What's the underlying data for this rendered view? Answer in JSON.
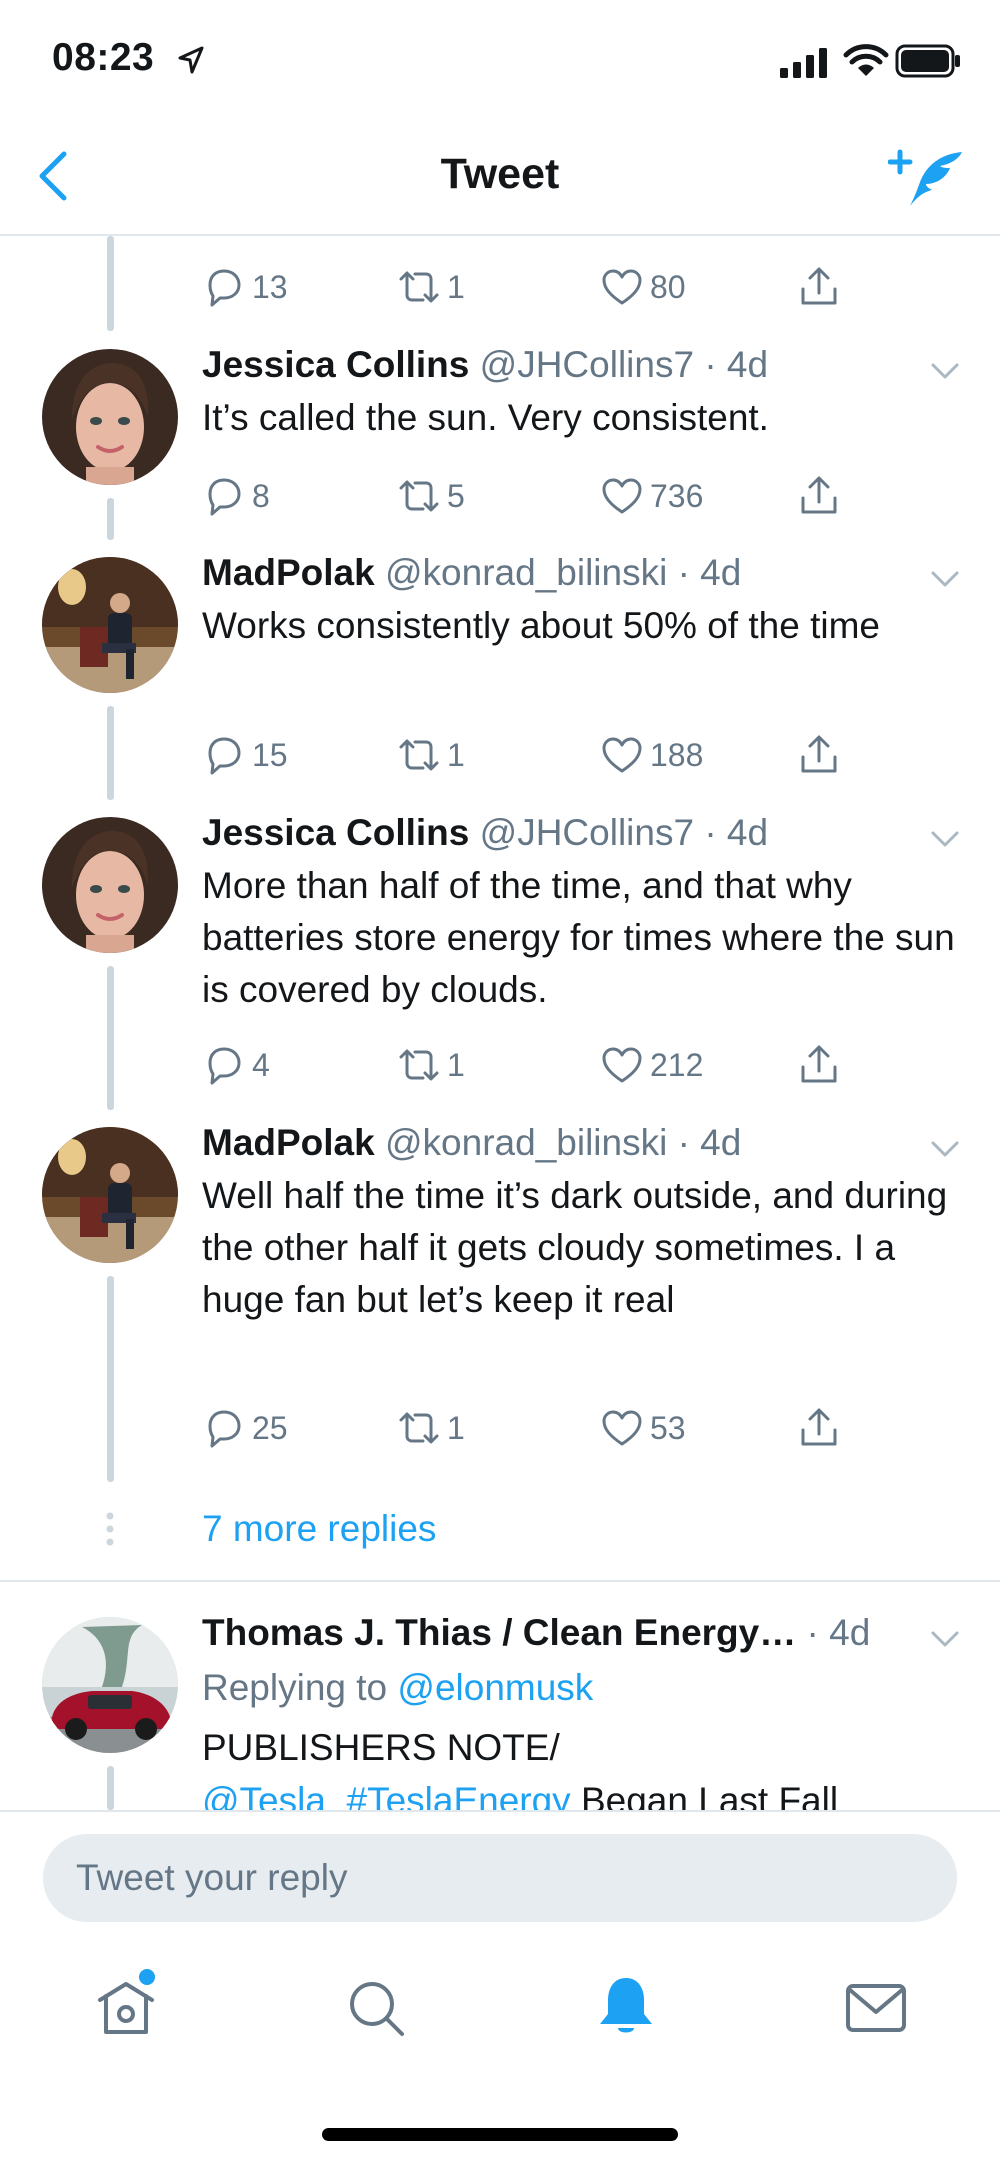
{
  "status_bar": {
    "time": "08:23"
  },
  "nav": {
    "title": "Tweet"
  },
  "top_actions": {
    "replies": "13",
    "retweets": "1",
    "likes": "80"
  },
  "tweets": [
    {
      "name": "Jessica Collins",
      "handle": "@JHCollins7 · 4d",
      "text": "It’s called the sun. Very consistent.",
      "replies": "8",
      "retweets": "5",
      "likes": "736"
    },
    {
      "name": "MadPolak",
      "handle": "@konrad_bilinski · 4d",
      "text": "Works consistently about 50% of the time",
      "replies": "15",
      "retweets": "1",
      "likes": "188"
    },
    {
      "name": "Jessica Collins",
      "handle": "@JHCollins7 · 4d",
      "text": "More than half of the time, and that why batteries store energy for times where the sun is covered by clouds.",
      "replies": "4",
      "retweets": "1",
      "likes": "212"
    },
    {
      "name": "MadPolak",
      "handle": "@konrad_bilinski · 4d",
      "text": "Well half the time it’s dark outside, and during the other half it gets cloudy sometimes. I a huge fan but let’s keep it real",
      "replies": "25",
      "retweets": "1",
      "likes": "53"
    }
  ],
  "more_replies": "7 more replies",
  "bottom_tweet": {
    "name": "Thomas J. Thias / Clean Energy…",
    "time": "· 4d",
    "replying_prefix": "Replying to",
    "replying_handle": "@elonmusk",
    "line1": "PUBLISHERS NOTE/",
    "line2_links": "@Tesla  #TeslaEnergy",
    "line2_rest": " Began Last Fall"
  },
  "reply_bar": {
    "placeholder": "Tweet your reply"
  },
  "tab_bar": {
    "tabs": [
      "home-icon",
      "search-icon",
      "notifications-icon",
      "messages-icon"
    ]
  },
  "colors": {
    "accent": "#1da1f2",
    "secondary_text": "#657786",
    "thread_line": "#ccd6dd"
  }
}
